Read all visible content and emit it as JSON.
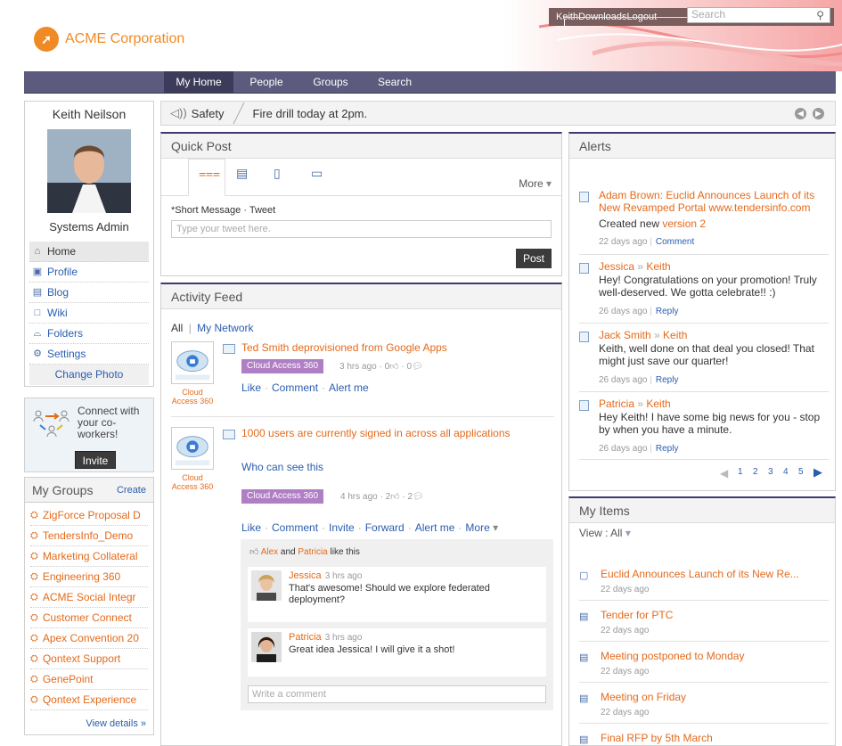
{
  "header": {
    "logo_text": "ACME Corporation",
    "user": "Keith",
    "downloads": "Downloads",
    "logout": "Logout",
    "search_placeholder": "Search"
  },
  "nav": {
    "tabs": [
      "My Home",
      "People",
      "Groups",
      "Search"
    ]
  },
  "profile": {
    "name": "Keith Neilson",
    "role": "Systems Admin",
    "menu": [
      "Home",
      "Profile",
      "Blog",
      "Wiki",
      "Folders",
      "Settings"
    ],
    "change_photo": "Change Photo"
  },
  "connect": {
    "text": "Connect with your co-workers!",
    "button": "Invite"
  },
  "groups": {
    "title": "My Groups",
    "create": "Create",
    "items": [
      "ZigForce Proposal D",
      "TendersInfo_Demo",
      "Marketing Collateral",
      "Engineering 360",
      "ACME Social Integr",
      "Customer Connect",
      "Apex Convention 20",
      "Qontext Support",
      "GenePoint",
      "Qontext Experience"
    ],
    "view_details": "View details »"
  },
  "ticker": {
    "label": "Safety",
    "message": "Fire drill today at 2pm."
  },
  "quickpost": {
    "title": "Quick Post",
    "more": "More",
    "label_req": "*Short Message",
    "label_tweet": "Tweet",
    "placeholder": "Type your tweet here.",
    "post": "Post"
  },
  "activity": {
    "title": "Activity Feed",
    "filter_all": "All",
    "filter_network": "My Network",
    "items": [
      {
        "avatar_label": "Cloud Access 360",
        "title": "Ted Smith deprovisioned from Google Apps",
        "badge": "Cloud Access 360",
        "time": "3 hrs ago",
        "likes": "0",
        "comments": "0",
        "actions": [
          "Like",
          "Comment",
          "Alert me"
        ]
      },
      {
        "avatar_label": "Cloud Access 360",
        "title": "1000 users are currently signed in across all applications",
        "who_can_see": "Who can see this",
        "badge": "Cloud Access 360",
        "time": "4 hrs ago",
        "likes": "2",
        "comments": "2",
        "actions": [
          "Like",
          "Comment",
          "Invite",
          "Forward",
          "Alert me",
          "More"
        ]
      }
    ],
    "likes_a": "Alex",
    "likes_and": " and ",
    "likes_b": "Patricia",
    "likes_suffix": " like this",
    "comments": [
      {
        "name": "Jessica",
        "time": "3 hrs ago",
        "text": "That's awesome! Should we explore federated deployment?"
      },
      {
        "name": "Patricia",
        "time": "3 hrs ago",
        "text": "Great idea Jessica! I will give it a shot!"
      }
    ],
    "comment_placeholder": "Write a comment"
  },
  "alerts": {
    "title": "Alerts",
    "items": [
      {
        "title": "Adam Brown: Euclid Announces Launch of its New Revamped Portal www.tendersinfo.com",
        "text_prefix": "Created new ",
        "text_link": "version 2",
        "time": "22 days ago",
        "action": "Comment"
      },
      {
        "from": "Jessica",
        "to": "Keith",
        "text": "Hey! Congratulations on your promotion! Truly well-deserved. We gotta celebrate!! :)",
        "time": "26 days ago",
        "action": "Reply"
      },
      {
        "from": "Jack Smith",
        "to": "Keith",
        "text": "Keith, well done on that deal you closed! That might just save our quarter!",
        "time": "26 days ago",
        "action": "Reply"
      },
      {
        "from": "Patricia",
        "to": "Keith",
        "text": "Hey Keith! I have some big news for you - stop by when you have a minute.",
        "time": "26 days ago",
        "action": "Reply"
      }
    ],
    "pages": [
      "1",
      "2",
      "3",
      "4",
      "5"
    ]
  },
  "myitems": {
    "title": "My Items",
    "view_label": "View :",
    "view_value": "All",
    "items": [
      {
        "title": "Euclid Announces Launch of its New Re...",
        "date": "22 days ago"
      },
      {
        "title": "Tender for PTC",
        "date": "22 days ago"
      },
      {
        "title": "Meeting postponed to Monday",
        "date": "22 days ago"
      },
      {
        "title": "Meeting on Friday",
        "date": "22 days ago"
      },
      {
        "title": "Final RFP by 5th March",
        "date": ""
      }
    ]
  }
}
